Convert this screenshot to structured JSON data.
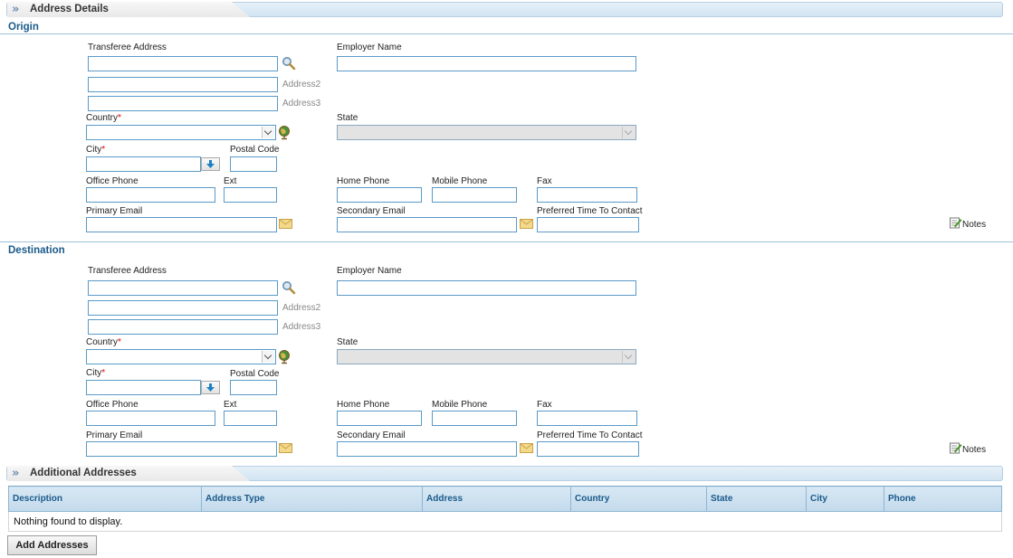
{
  "address_details": {
    "title": "Address Details"
  },
  "origin": {
    "title": "Origin",
    "transferee_address_label": "Transferee Address",
    "employer_name_label": "Employer Name",
    "address2_label": "Address2",
    "address3_label": "Address3",
    "country_label": "Country",
    "state_label": "State",
    "city_label": "City",
    "postal_code_label": "Postal Code",
    "office_phone_label": "Office Phone",
    "ext_label": "Ext",
    "home_phone_label": "Home Phone",
    "mobile_phone_label": "Mobile Phone",
    "fax_label": "Fax",
    "primary_email_label": "Primary Email",
    "secondary_email_label": "Secondary Email",
    "preferred_time_label": "Preferred Time To Contact",
    "notes_label": "Notes",
    "required_mark": "*"
  },
  "destination": {
    "title": "Destination",
    "transferee_address_label": "Transferee Address",
    "employer_name_label": "Employer Name",
    "address2_label": "Address2",
    "address3_label": "Address3",
    "country_label": "Country",
    "state_label": "State",
    "city_label": "City",
    "postal_code_label": "Postal Code",
    "office_phone_label": "Office Phone",
    "ext_label": "Ext",
    "home_phone_label": "Home Phone",
    "mobile_phone_label": "Mobile Phone",
    "fax_label": "Fax",
    "primary_email_label": "Primary Email",
    "secondary_email_label": "Secondary Email",
    "preferred_time_label": "Preferred Time To Contact",
    "notes_label": "Notes",
    "required_mark": "*"
  },
  "additional_addresses": {
    "title": "Additional Addresses",
    "columns": [
      "Description",
      "Address Type",
      "Address",
      "Country",
      "State",
      "City",
      "Phone"
    ],
    "empty_message": "Nothing found to display.",
    "add_button_label": "Add Addresses"
  },
  "colors": {
    "accent": "#1a5a8a",
    "input_border": "#5a9ac8",
    "required": "#dd0000"
  },
  "icons": [
    "chevrons-right-icon",
    "search-icon",
    "globe-icon",
    "download-arrow-icon",
    "envelope-icon",
    "notes-icon"
  ]
}
